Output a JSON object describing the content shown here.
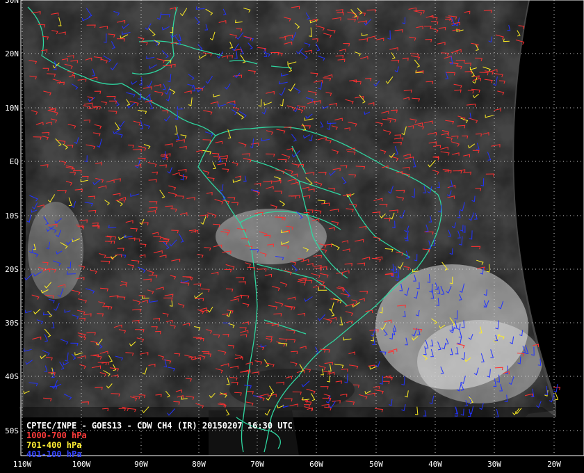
{
  "caption": {
    "title": "CPTEC/INPE - GOES13 - CDW CH4 (IR) 20150207 16:30 UTC",
    "layers": [
      {
        "label": "1000-700 hPa",
        "color": "#ff3030"
      },
      {
        "label": "701-400 hPa",
        "color": "#ffee22"
      },
      {
        "label": "401-100 hPa",
        "color": "#2233ff"
      }
    ]
  },
  "lat_labels": [
    "30N",
    "20N",
    "10N",
    "EQ",
    "10S",
    "20S",
    "30S",
    "40S",
    "50S"
  ],
  "lon_labels": [
    "110W",
    "100W",
    "90W",
    "80W",
    "70W",
    "60W",
    "50W",
    "40W",
    "30W",
    "20W"
  ],
  "colors": {
    "coastline": "#2fd6a0",
    "grid": "#cfcfcf",
    "background": "#000000",
    "cloud_base": "#3a3a3a"
  }
}
